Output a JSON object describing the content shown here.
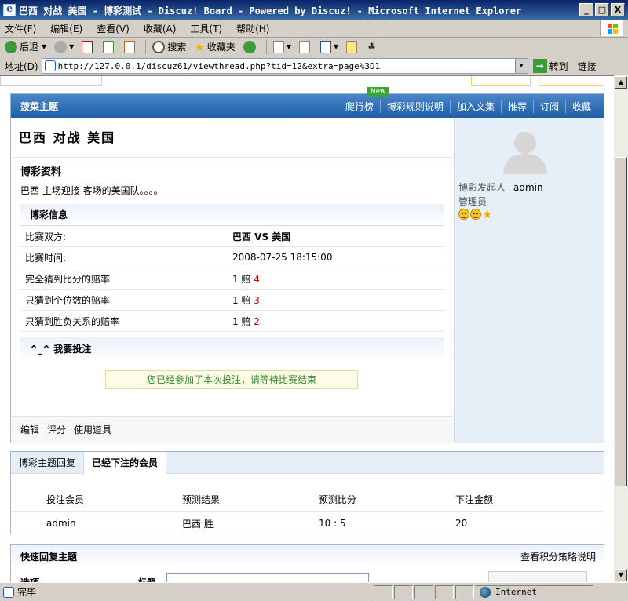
{
  "window": {
    "title": "巴西 对战 美国 - 博彩测试 - Discuz! Board - Powered by Discuz! - Microsoft Internet Explorer",
    "buttons": [
      "_",
      "□",
      "X"
    ]
  },
  "menu": [
    "文件(F)",
    "编辑(E)",
    "查看(V)",
    "收藏(A)",
    "工具(T)",
    "帮助(H)"
  ],
  "toolbar": {
    "back": "后退",
    "search": "搜索",
    "favorites": "收藏夹"
  },
  "address": {
    "label": "地址(D)",
    "url": "http://127.0.0.1/discuz61/viewthread.php?tid=12&extra=page%3D1",
    "go": "转到",
    "links": "链接"
  },
  "thread_box": {
    "header_title": "菠菜主题",
    "header_links": [
      "爬行榜",
      "博彩规则说明",
      "加入文集",
      "推荐",
      "订阅",
      "收藏"
    ],
    "new_badge": "New",
    "thread_title": "巴西 对战 美国",
    "bet_title": "博彩资料",
    "bet_desc": "巴西 主场迎接 客场的美国队。。。。",
    "info_header": "博彩信息",
    "info_rows": [
      {
        "k": "比赛双方:",
        "v": "巴西 VS 美国",
        "odds": ""
      },
      {
        "k": "比赛时间:",
        "v": "2008-07-25 18:15:00",
        "odds": ""
      },
      {
        "k": "完全猜到比分的赔率",
        "v": "1 赔",
        "odds": "4"
      },
      {
        "k": "只猜到个位数的赔率",
        "v": "1 赔",
        "odds": "3"
      },
      {
        "k": "只猜到胜负关系的赔率",
        "v": "1 赔",
        "odds": "2"
      }
    ],
    "bet_section": "^_^ 我要投注",
    "joined_msg": "您已经参加了本次投注，请等待比赛结束",
    "actions": [
      "编辑",
      "评分",
      "使用道具"
    ],
    "poster_label": "博彩发起人",
    "poster_name": "admin",
    "poster_role": "管理员"
  },
  "tabs_box": {
    "tabs": [
      "博彩主题回复",
      "已经下注的会员"
    ],
    "columns": [
      "投注会员",
      "预测结果",
      "预测比分",
      "下注金额"
    ],
    "rows": [
      [
        "admin",
        "巴西 胜",
        "10 : 5",
        "20"
      ]
    ]
  },
  "reply_box": {
    "title": "快速回复主题",
    "right_link": "查看积分策略说明",
    "options_label": "选项",
    "title_label": "标题"
  },
  "status": {
    "text": "完毕",
    "zone": "Internet"
  }
}
